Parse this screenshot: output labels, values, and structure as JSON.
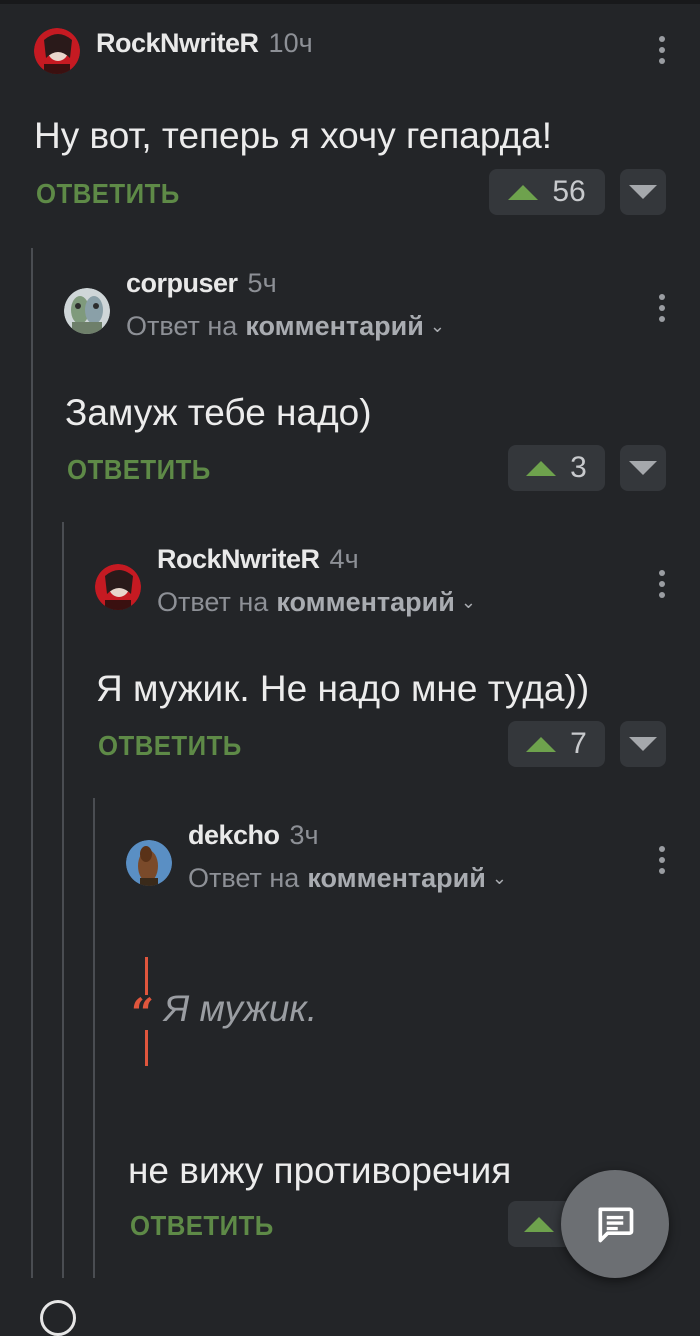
{
  "comments": [
    {
      "username": "RockNwriteR",
      "time": "10ч",
      "text": "Ну вот, теперь я хочу гепарда!",
      "reply_label": "ОТВЕТИТЬ",
      "votes": "56"
    },
    {
      "username": "corpuser",
      "time": "5ч",
      "reply_prefix": "Ответ на",
      "reply_target": "комментарий",
      "text": "Замуж тебе надо)",
      "reply_label": "ОТВЕТИТЬ",
      "votes": "3"
    },
    {
      "username": "RockNwriteR",
      "time": "4ч",
      "reply_prefix": "Ответ на",
      "reply_target": "комментарий",
      "text": "Я мужик. Не надо мне туда))",
      "reply_label": "ОТВЕТИТЬ",
      "votes": "7"
    },
    {
      "username": "dekcho",
      "time": "3ч",
      "reply_prefix": "Ответ на",
      "reply_target": "комментарий",
      "quote": "Я мужик.",
      "text": "не вижу противоречия",
      "reply_label": "ОТВЕТИТЬ",
      "votes": ""
    }
  ],
  "colors": {
    "background": "#232528",
    "accent_green": "#5e8a47",
    "upvote": "#6ea24d",
    "quote_red": "#e0563d"
  },
  "icons": {
    "fab": "comment-icon",
    "menu": "more-vertical-icon"
  }
}
